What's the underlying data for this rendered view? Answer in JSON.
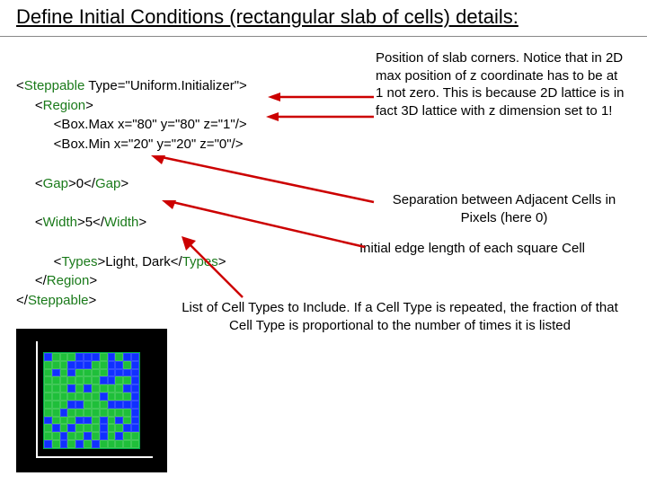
{
  "title": "Define Initial Conditions (rectangular slab of cells) details:",
  "code": {
    "l1a": "<",
    "l1b": "Steppable",
    "l1c": " Type=\"Uniform.Initializer\">",
    "l2a": "     <",
    "l2b": "Region",
    "l2c": ">",
    "l3": "          <Box.Max x=\"80\" y=\"80\" z=\"1\"/>",
    "l4": "          <Box.Min x=\"20\" y=\"20\" z=\"0\"/>",
    "l5a": "     <",
    "l5b": "Gap",
    "l5c": ">0</",
    "l5d": "Gap",
    "l5e": ">",
    "l6a": "     <",
    "l6b": "Width",
    "l6c": ">5</",
    "l6d": "Width",
    "l6e": ">",
    "l7a": "          <",
    "l7b": "Types",
    "l7c": ">Light, Dark</",
    "l7d": "Types",
    "l7e": ">",
    "l8a": "     </",
    "l8b": "Region",
    "l8c": ">",
    "l9a": "</",
    "l9b": "Steppable",
    "l9c": ">"
  },
  "notes": {
    "n1": "Position of slab corners. Notice that in 2D max position of z coordinate has to be at 1 not zero. This is because 2D lattice is in fact 3D lattice with z dimension set to 1!",
    "n2": "Separation between Adjacent Cells in Pixels (here 0)",
    "n3": "Initial edge length of  each square Cell",
    "n4": "List of Cell Types to Include. If a Cell Type is repeated, the fraction of that Cell Type is proportional to the number of times it is listed"
  },
  "colors": {
    "arrow": "#cc0000",
    "tag": "#1a7a1a",
    "sim_green": "#1fbf3a",
    "sim_blue": "#1030ff"
  }
}
